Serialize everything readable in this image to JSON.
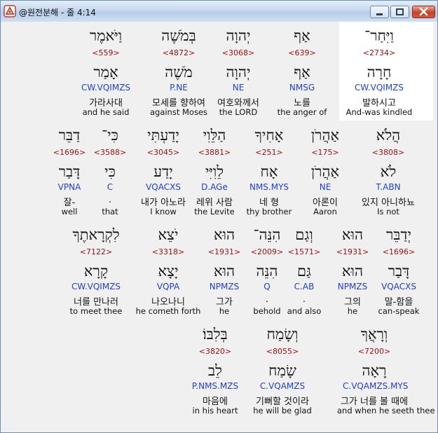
{
  "window": {
    "title": "@원전분해 - 줄 4:14"
  },
  "rows": [
    [
      {
        "heb": "וַיִּחַר־",
        "strong": "<2734>",
        "lemma": "חָרָה",
        "morph": "CW.VQIMZS",
        "kor": "발하시고",
        "eng": "And-was kindled"
      },
      {
        "heb": "אַף",
        "strong": "<639>",
        "lemma": "אַף",
        "morph": "NMSG",
        "kor": "노를",
        "eng": "the anger of"
      },
      {
        "heb": "יְהוָה",
        "strong": "<3068>",
        "lemma": "יְהוָה",
        "morph": "NE",
        "kor": "여호와께서",
        "eng": "the LORD"
      },
      {
        "heb": "בְּמֹשֶׁה",
        "strong": "<4872>",
        "lemma": "מֹשֶׁה",
        "morph": "P.NE",
        "kor": "모세를 향하여",
        "eng": "against Moses"
      },
      {
        "heb": "וַיֹּאמֶר",
        "strong": "<559>",
        "lemma": "אָמַר",
        "morph": "CW.VQIMZS",
        "kor": "가라사대",
        "eng": "and he said"
      }
    ],
    [
      {
        "heb": "הֲלֹא",
        "strong": "<3808>",
        "lemma": "לֹא",
        "morph": "T.ABN",
        "kor": "있지 아니하뇨",
        "eng": "Is not"
      },
      {
        "heb": "אַהֲרֹן",
        "strong": "<175>",
        "lemma": "אַהֲרֹן",
        "morph": "NE",
        "kor": "아론이",
        "eng": "Aaron"
      },
      {
        "heb": "אָחִיךָ",
        "strong": "<251>",
        "lemma": "אָח",
        "morph": "NMS.MYS",
        "kor": "네 형",
        "eng": "thy brother"
      },
      {
        "heb": "הַלֵּוִי",
        "strong": "<3881>",
        "lemma": "לֵוִיִּי",
        "morph": "D.AGe",
        "kor": "레위 사람",
        "eng": "the Levite"
      },
      {
        "heb": "יָדַעְתִּי",
        "strong": "<3045>",
        "lemma": "יָדַע",
        "morph": "VQACXS",
        "kor": "내가 아노라",
        "eng": "I know"
      },
      {
        "heb": "כִּי־",
        "strong": "<3588>",
        "lemma": "כִּי",
        "morph": "C",
        "kor": ".",
        "eng": "that"
      },
      {
        "heb": "דַבֵּר",
        "strong": "<1696>",
        "lemma": "דָּבַר",
        "morph": "VPNA",
        "kor": "잘-",
        "eng": "well"
      }
    ],
    [
      {
        "heb": "יְדַבֵּר",
        "strong": "<1696>",
        "lemma": "דָּבַר",
        "morph": "VQACXS",
        "kor": "말-함을",
        "eng": "can-speak"
      },
      {
        "heb": "הוּא",
        "strong": "<1931>",
        "lemma": "הוּא",
        "morph": "NPMZS",
        "kor": "그의",
        "eng": "he"
      },
      {
        "heb": "וְגַם",
        "strong": "<1571>",
        "lemma": "גַּם",
        "morph": "C.AB",
        "kor": ".",
        "eng": "and also"
      },
      {
        "heb": "הִנֵּה־",
        "strong": "<2009>",
        "lemma": "הִנֵּה",
        "morph": "Q",
        "kor": ".",
        "eng": "behold"
      },
      {
        "heb": "הוּא",
        "strong": "<1931>",
        "lemma": "הוּא",
        "morph": "NPMZS",
        "kor": "그가",
        "eng": "he"
      },
      {
        "heb": "יֹצֵא",
        "strong": "<3318>",
        "lemma": "יָצָא",
        "morph": "VQPA",
        "kor": "나오나니",
        "eng": "he cometh forth"
      },
      {
        "heb": "לִקְרָאתֶךָ",
        "strong": "<7122>",
        "lemma": "קָרָא",
        "morph": "CW.VQIMZS",
        "kor": "너를 만나러",
        "eng": "to meet thee"
      }
    ],
    [
      {
        "heb": "וְרָאֲךָ",
        "strong": "<7200>",
        "lemma": "רָאָה",
        "morph": "C.VQAMZS.MYS",
        "kor": "그가 너를 볼 때에",
        "eng": "and when he seeth thee"
      },
      {
        "heb": "וְשָׂמַח",
        "strong": "<8055>",
        "lemma": "שָׂמַח",
        "morph": "C.VQAMZS",
        "kor": "기뻐할 것이라",
        "eng": "he will be glad"
      },
      {
        "heb": "בְּלִבּוֹ׃",
        "strong": "<3820>",
        "lemma": "לֵב",
        "morph": "P.NMS.MZS",
        "kor": "마음에",
        "eng": "in his heart"
      }
    ]
  ]
}
